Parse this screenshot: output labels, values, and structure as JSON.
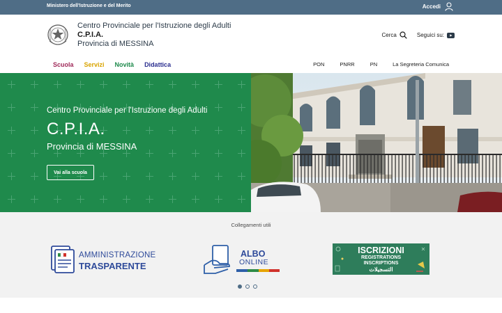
{
  "topbar": {
    "ministry": "Ministero dell'Istruzione e del Merito",
    "login_label": "Accedi"
  },
  "brand": {
    "line1": "Centro Provinciale per l'Istruzione degli Adulti",
    "abbr": "C.P.I.A.",
    "line3": "Provincia di MESSINA"
  },
  "tools": {
    "search_label": "Cerca",
    "social_label": "Seguici su:"
  },
  "main_nav": [
    {
      "label": "Scuola",
      "color": "#a02a5a"
    },
    {
      "label": "Servizi",
      "color": "#d9a400"
    },
    {
      "label": "Novità",
      "color": "#1f8a4c"
    },
    {
      "label": "Didattica",
      "color": "#2a2e8f"
    }
  ],
  "secondary_nav": [
    "PON",
    "PNRR",
    "PN",
    "La Segreteria Comunica"
  ],
  "hero": {
    "subtitle": "Centro Provinciale per l'Istruzione degli Adulti",
    "title": "C.P.I.A.",
    "province": "Provincia di MESSINA",
    "button_label": "Vai alla scuola"
  },
  "useful_links": {
    "title": "Collegamenti utili",
    "amministrazione": {
      "line1": "AMMINISTRAZIONE",
      "line2": "TRASPARENTE"
    },
    "albo": {
      "line1": "ALBO",
      "line2": "ONLINE"
    },
    "iscrizioni": {
      "line1": "ISCRIZIONI",
      "line2": "REGISTRATIONS",
      "line3": "INSCRIPTIONS",
      "line4": "التسجيلات"
    }
  },
  "carousel": {
    "pages": 3,
    "active_page": 1
  },
  "colors": {
    "topbar": "#4f6d86",
    "hero_green": "#1f8a4c",
    "links_bg": "#f2f2f2"
  }
}
